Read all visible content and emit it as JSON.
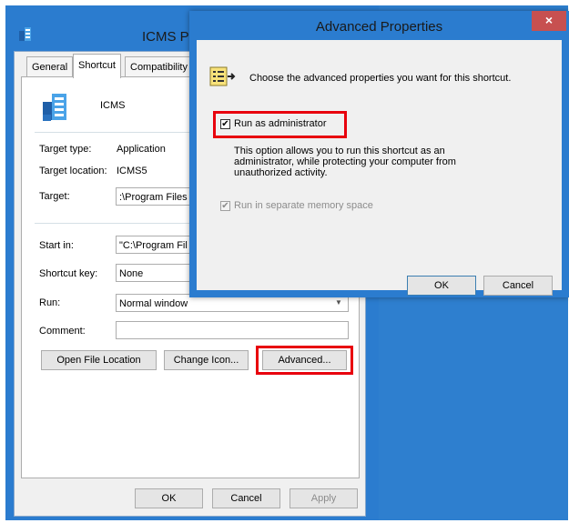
{
  "props_window": {
    "title": "ICMS P",
    "tabs": [
      "General",
      "Shortcut",
      "Compatibility"
    ],
    "app_name": "ICMS",
    "target_type_label": "Target type:",
    "target_type_value": "Application",
    "target_location_label": "Target location:",
    "target_location_value": "ICMS5",
    "target_label": "Target:",
    "target_value": ":\\Program Files",
    "start_in_label": "Start in:",
    "start_in_value": "\"C:\\Program Fil",
    "shortcut_key_label": "Shortcut key:",
    "shortcut_key_value": "None",
    "run_label": "Run:",
    "run_value": "Normal window",
    "comment_label": "Comment:",
    "comment_value": "",
    "open_file_location": "Open File Location",
    "change_icon": "Change Icon...",
    "advanced": "Advanced...",
    "ok": "OK",
    "cancel": "Cancel",
    "apply": "Apply"
  },
  "advanced_dialog": {
    "title": "Advanced Properties",
    "close_symbol": "×",
    "description": "Choose the advanced properties you want for this shortcut.",
    "run_as_admin_label": "Run as administrator",
    "run_as_admin_checked": true,
    "run_as_admin_help_1": "This option allows you to run this shortcut as an",
    "run_as_admin_help_2": "administrator, while protecting your computer from",
    "run_as_admin_help_3": "unauthorized activity.",
    "separate_memory_label": "Run in separate memory space",
    "ok": "OK",
    "cancel": "Cancel"
  },
  "colors": {
    "window_frame": "#2b7ccf",
    "highlight_red": "#e8000d",
    "close_button": "#c75050"
  }
}
